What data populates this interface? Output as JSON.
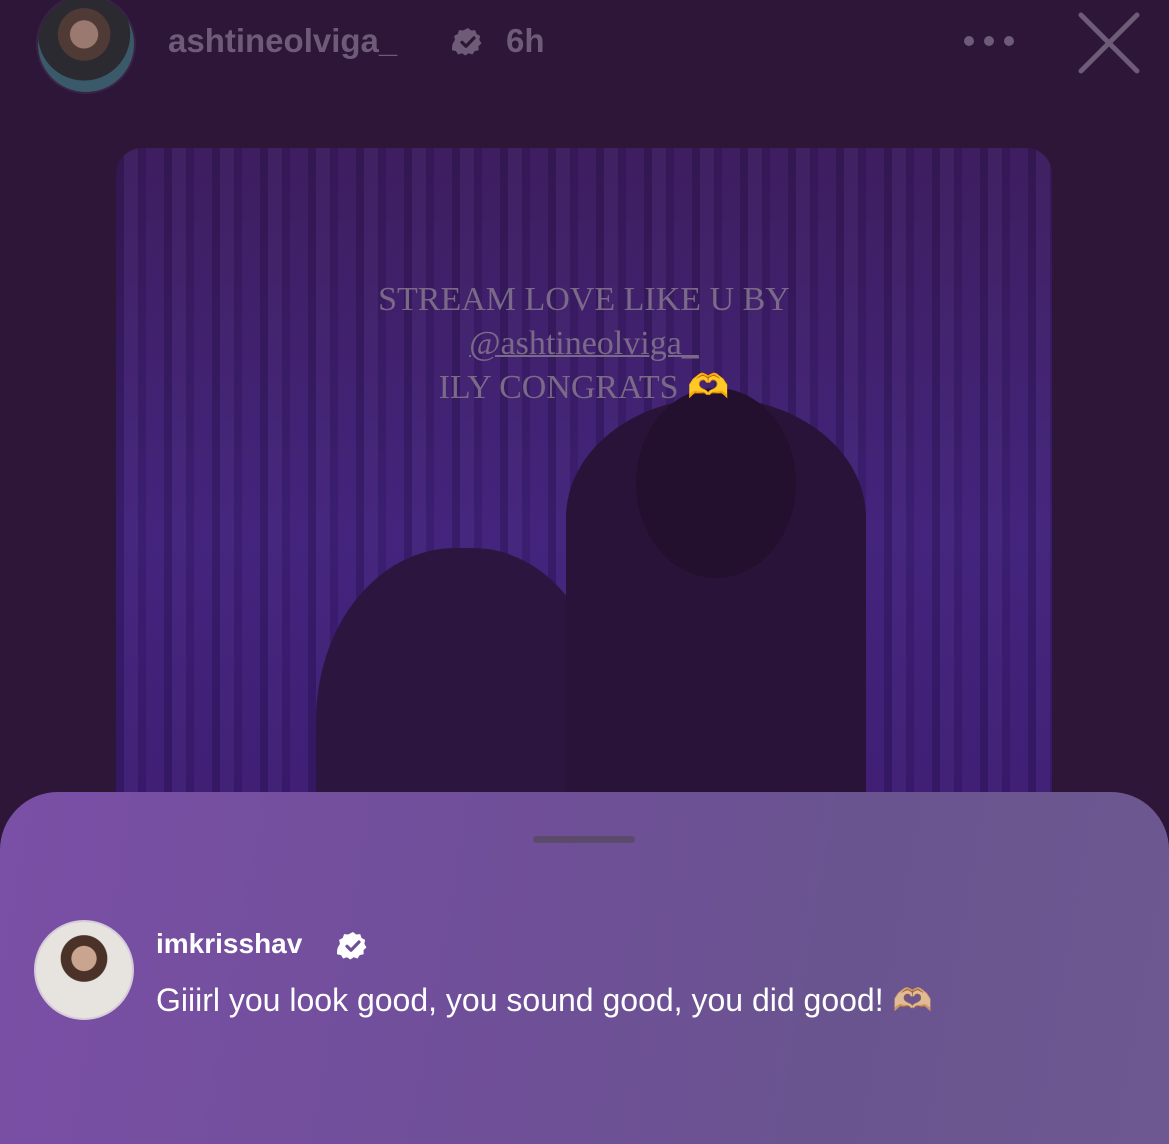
{
  "header": {
    "username": "ashtineolviga_",
    "time": "6h"
  },
  "story": {
    "line1": "STREAM LOVE LIKE U BY",
    "mention": "@ashtineolviga_",
    "line3": "ILY CONGRATS 🫶"
  },
  "comment": {
    "username": "imkrisshav",
    "text": "Giiirl you look good, you sound good, you did good! 🫶🏼"
  },
  "colors": {
    "background": "#2d1638",
    "sheet": "#7a4fa6",
    "muted_text": "#6e5b78"
  },
  "icons": [
    "verified-badge-icon",
    "more-options-icon",
    "close-icon"
  ]
}
